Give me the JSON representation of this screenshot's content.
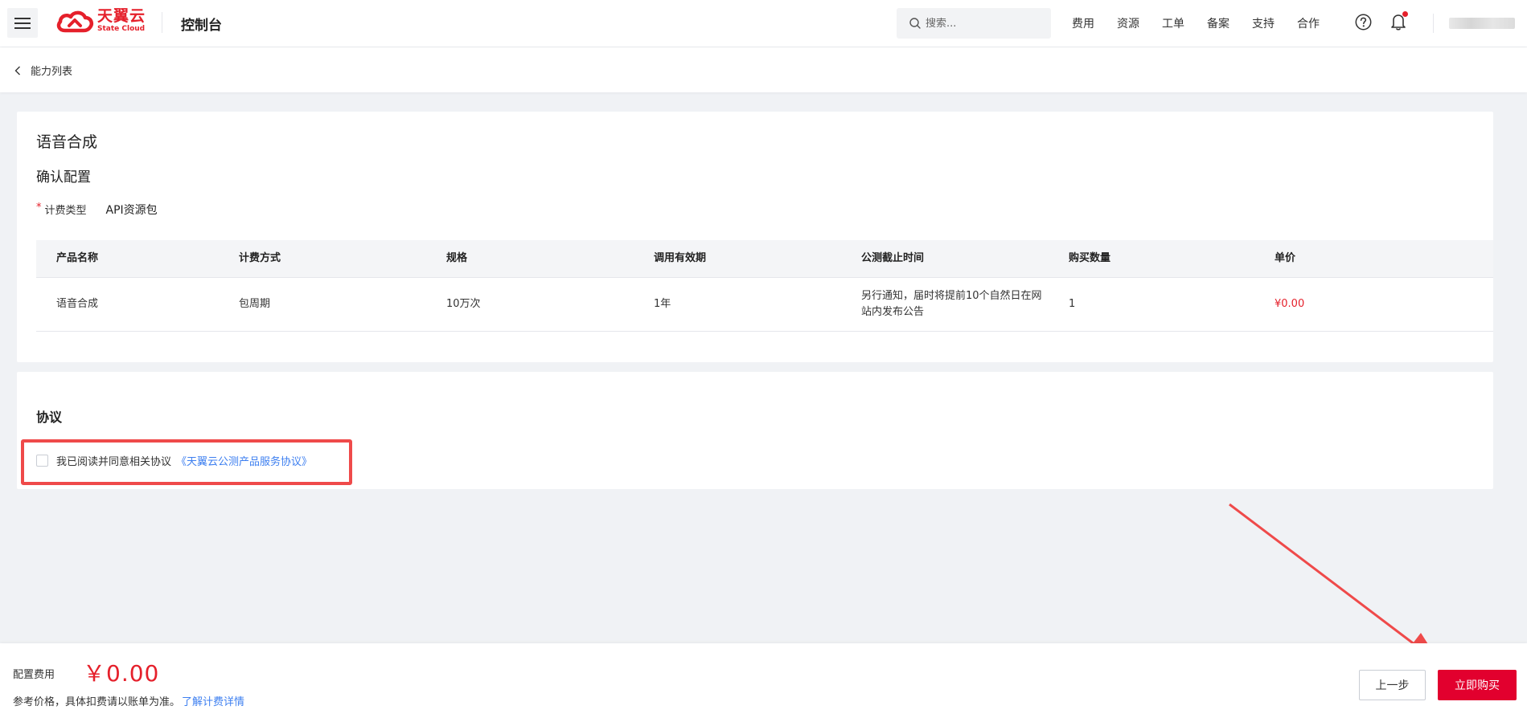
{
  "topnav": {
    "logo_cn": "天翼云",
    "logo_en": "State Cloud",
    "console_title": "控制台",
    "search_placeholder": "搜索...",
    "links": [
      "费用",
      "资源",
      "工单",
      "备案",
      "支持",
      "合作"
    ],
    "brand_color": "#e5202b"
  },
  "breadcrumb": {
    "back_label": "能力列表"
  },
  "config": {
    "page_title": "语音合成",
    "section_title": "确认配置",
    "billing_type_label": "计费类型",
    "billing_type_value": "API资源包",
    "table": {
      "headers": [
        "产品名称",
        "计费方式",
        "规格",
        "调用有效期",
        "公测截止时间",
        "购买数量",
        "单价"
      ],
      "rows": [
        [
          "语音合成",
          "包周期",
          "10万次",
          "1年",
          "另行通知，届时将提前10个自然日在网站内发布公告",
          "1",
          "¥0.00"
        ]
      ]
    }
  },
  "agreement": {
    "title": "协议",
    "text": "我已阅读并同意相关协议",
    "link_text": "《天翼云公测产品服务协议》",
    "checked": false
  },
  "footer": {
    "cost_label": "配置费用",
    "cost_value": "￥0.00",
    "note": "参考价格，具体扣费请以账单为准。",
    "note_link": "了解计费详情",
    "prev_button": "上一步",
    "buy_button": "立即购买",
    "buy_color": "#e2002e"
  }
}
